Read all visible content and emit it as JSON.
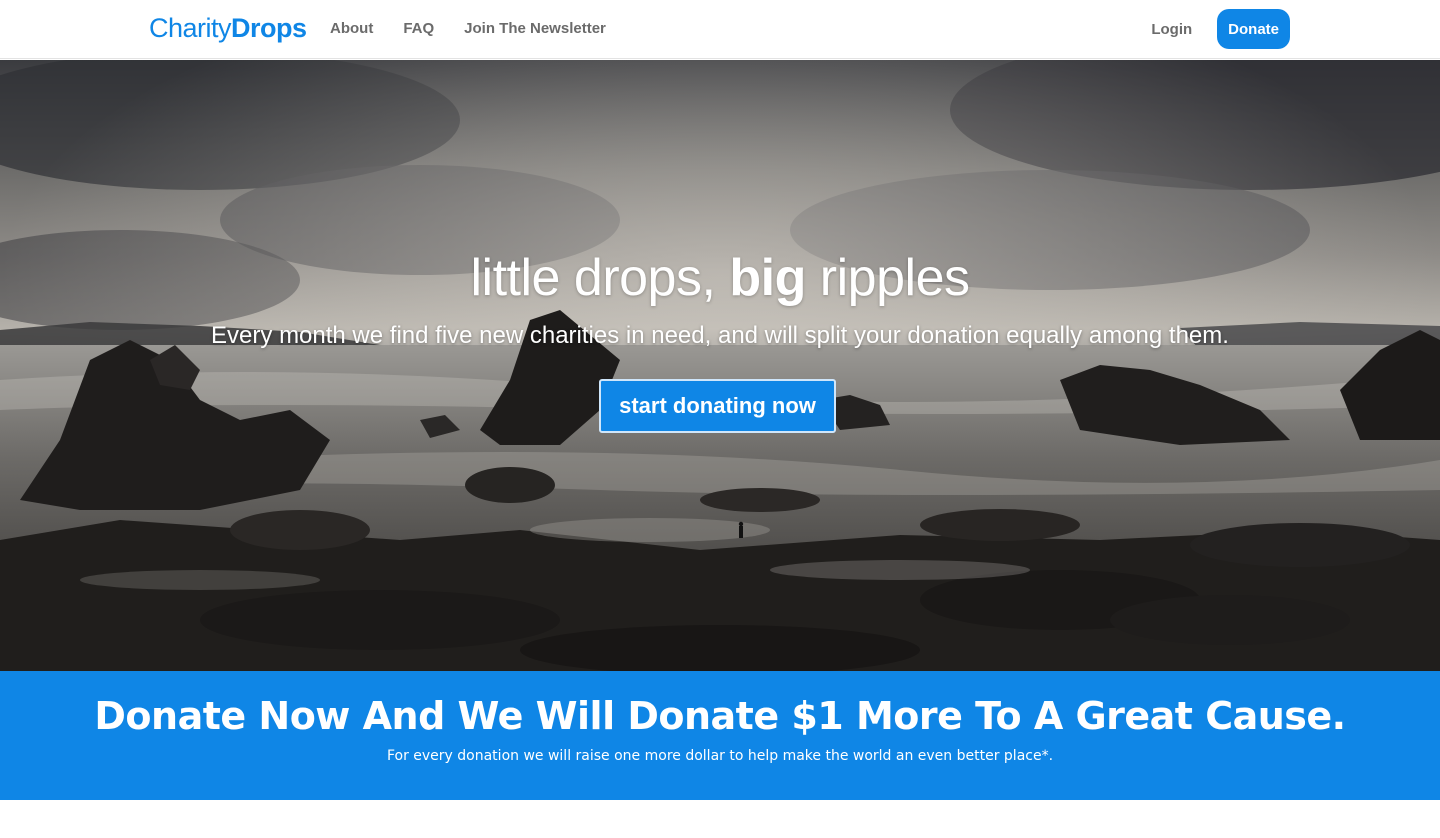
{
  "brand": {
    "name_light": "Charity",
    "name_bold": "Drops",
    "accent_color": "#0f86e6"
  },
  "nav": {
    "links": [
      {
        "label": "About"
      },
      {
        "label": "FAQ"
      },
      {
        "label": "Join The Newsletter"
      }
    ],
    "login_label": "Login",
    "donate_label": "Donate"
  },
  "hero": {
    "title_part1": "little drops, ",
    "title_bold": "big",
    "title_part2": " ripples",
    "subtitle": "Every month we find five new charities in need, and will split your donation equally among them.",
    "cta_label": "start donating now"
  },
  "promo": {
    "title": "Donate Now And We Will Donate $1 More To A Great Cause.",
    "subtitle": "For every donation we will raise one more dollar to help make the world an even better place*."
  }
}
